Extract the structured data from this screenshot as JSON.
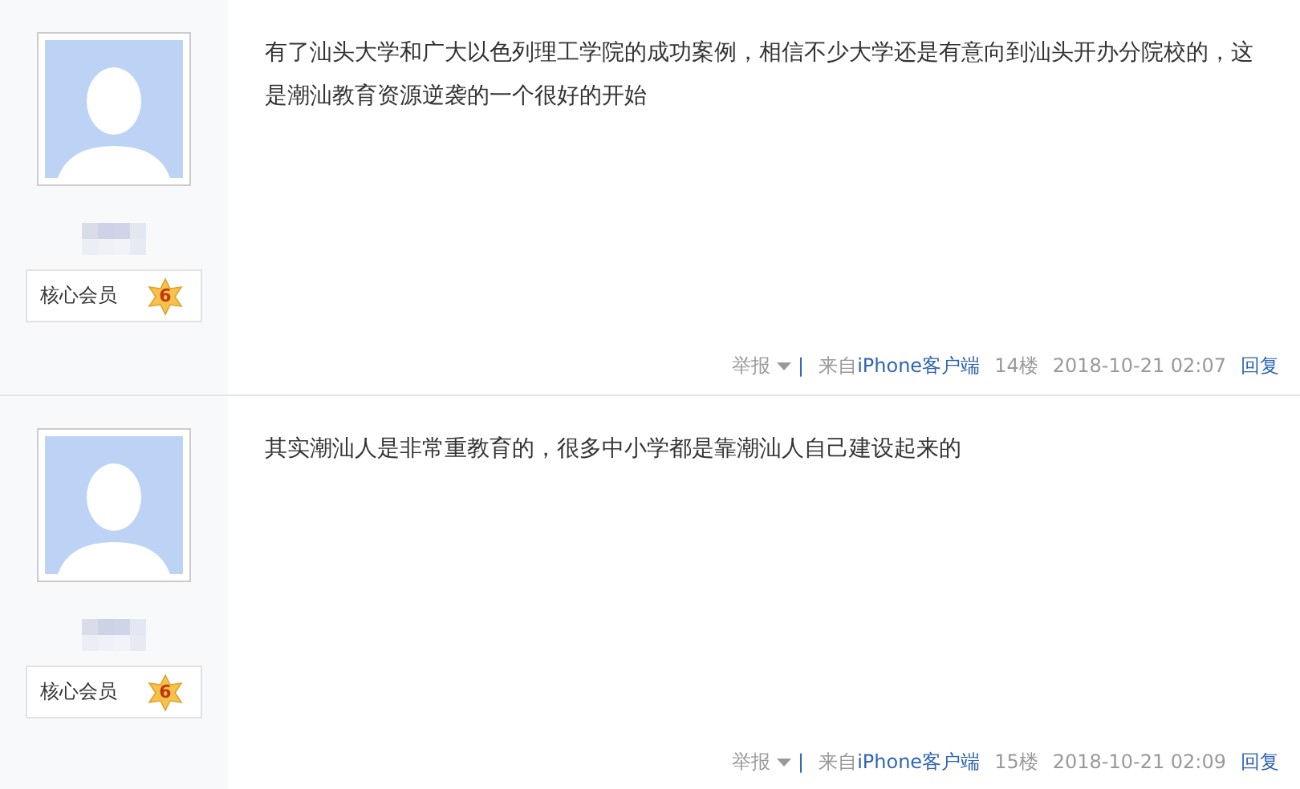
{
  "posts": [
    {
      "rank": "核心会员",
      "level_badge": "6",
      "text": "有了汕头大学和广大以色列理工学院的成功案例，相信不少大学还是有意向到汕头开办分院校的，这是潮汕教育资源逆袭的一个很好的开始",
      "report": "举报",
      "separator": "|",
      "source_prefix": "来自",
      "source_link": "iPhone客户端",
      "floor": "14楼",
      "time": "2018-10-21 02:07",
      "reply": "回复"
    },
    {
      "rank": "核心会员",
      "level_badge": "6",
      "text": "其实潮汕人是非常重教育的，很多中小学都是靠潮汕人自己建设起来的",
      "report": "举报",
      "separator": "|",
      "source_prefix": "来自",
      "source_link": "iPhone客户端",
      "floor": "15楼",
      "time": "2018-10-21 02:09",
      "reply": "回复"
    }
  ]
}
